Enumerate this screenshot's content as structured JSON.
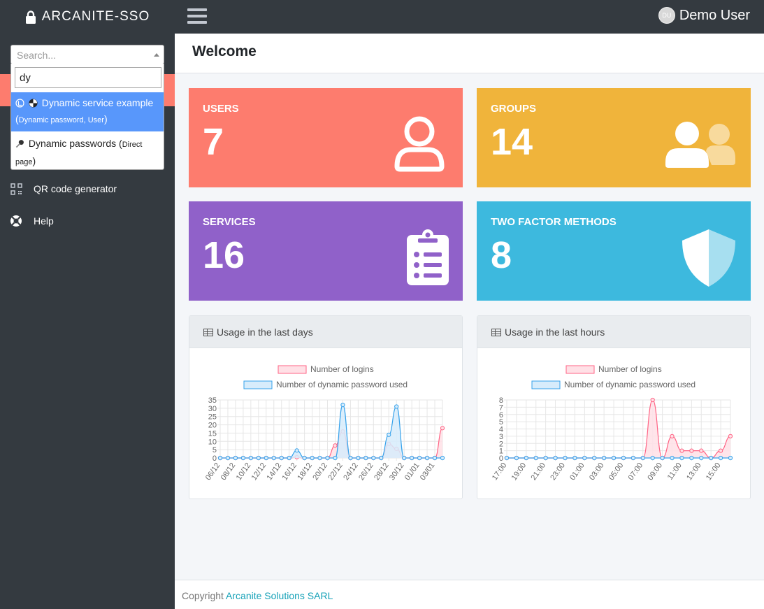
{
  "header": {
    "brand": "ARCANITE-SSO",
    "user_name": "Demo User",
    "user_initials": "DU"
  },
  "sidebar": {
    "search": {
      "placeholder": "Search...",
      "query": "dy",
      "results": [
        {
          "title": "Dynamic service example",
          "open": "(",
          "detail": "Dynamic password, User",
          "close": ")",
          "selected": true
        },
        {
          "title": "Dynamic passwords",
          "open": "(",
          "detail": "Direct page",
          "close": ")",
          "selected": false
        }
      ]
    },
    "items": [
      {
        "label": "QR code generator",
        "icon": "qr-code-icon"
      },
      {
        "label": "Help",
        "icon": "life-ring-icon"
      }
    ]
  },
  "page": {
    "title": "Welcome"
  },
  "stats": [
    {
      "label": "USERS",
      "value": "7",
      "color": "#fd7c6e",
      "icon": "user-icon"
    },
    {
      "label": "GROUPS",
      "value": "14",
      "color": "#f0b43b",
      "icon": "users-icon"
    },
    {
      "label": "SERVICES",
      "value": "16",
      "color": "#9061c9",
      "icon": "clipboard-list-icon"
    },
    {
      "label": "TWO FACTOR METHODS",
      "value": "8",
      "color": "#3db9de",
      "icon": "shield-icon"
    }
  ],
  "cards": {
    "days_title": "Usage in the last days",
    "hours_title": "Usage in the last hours"
  },
  "chart_data": [
    {
      "type": "area",
      "title": "Usage in the last days",
      "x": [
        "06/12",
        "07/12",
        "08/12",
        "09/12",
        "10/12",
        "11/12",
        "12/12",
        "13/12",
        "14/12",
        "15/12",
        "16/12",
        "17/12",
        "18/12",
        "19/12",
        "20/12",
        "21/12",
        "22/12",
        "23/12",
        "24/12",
        "25/12",
        "26/12",
        "27/12",
        "28/12",
        "29/12",
        "30/12",
        "31/12",
        "01/01",
        "02/01",
        "03/01",
        "04/01"
      ],
      "x_ticks": [
        "06/12",
        "08/12",
        "10/12",
        "12/12",
        "14/12",
        "16/12",
        "18/12",
        "20/12",
        "22/12",
        "24/12",
        "26/12",
        "28/12",
        "30/12",
        "01/01",
        "03/01"
      ],
      "y_ticks": [
        0,
        5,
        10,
        15,
        20,
        25,
        30,
        35
      ],
      "ylim": [
        0,
        35
      ],
      "grid": true,
      "legend_position": "top",
      "series": [
        {
          "name": "Number of logins",
          "color": "#ff6384",
          "fill": "#ffe0e6",
          "values": [
            0,
            0,
            0,
            0,
            0,
            0,
            0,
            0,
            0,
            0,
            0.5,
            0,
            0,
            0,
            0,
            7.5,
            16,
            0,
            0,
            0,
            0,
            0,
            8.5,
            5.5,
            0,
            0,
            0,
            0,
            0,
            18
          ]
        },
        {
          "name": "Number of dynamic password used",
          "color": "#36a2eb",
          "fill": "#d7ecfb",
          "values": [
            0,
            0,
            0,
            0,
            0,
            0,
            0,
            0,
            0,
            0,
            4.5,
            0,
            0,
            0,
            0,
            0,
            32,
            0,
            0,
            0,
            0,
            0,
            14,
            31,
            0,
            0,
            0,
            0,
            0,
            0
          ]
        }
      ]
    },
    {
      "type": "area",
      "title": "Usage in the last hours",
      "x": [
        "17:00",
        "18:00",
        "19:00",
        "20:00",
        "21:00",
        "22:00",
        "23:00",
        "00:00",
        "01:00",
        "02:00",
        "03:00",
        "04:00",
        "05:00",
        "06:00",
        "07:00",
        "08:00",
        "09:00",
        "10:00",
        "11:00",
        "12:00",
        "13:00",
        "14:00",
        "15:00",
        "16:00"
      ],
      "x_ticks": [
        "17:00",
        "19:00",
        "21:00",
        "23:00",
        "01:00",
        "03:00",
        "05:00",
        "07:00",
        "09:00",
        "11:00",
        "13:00",
        "15:00"
      ],
      "y_ticks": [
        0,
        1,
        2,
        3,
        4,
        5,
        6,
        7,
        8
      ],
      "ylim": [
        0,
        8
      ],
      "grid": true,
      "legend_position": "top",
      "series": [
        {
          "name": "Number of logins",
          "color": "#ff6384",
          "fill": "#ffe0e6",
          "values": [
            0,
            0,
            0,
            0,
            0,
            0,
            0,
            0,
            0,
            0,
            0,
            0,
            0,
            0,
            0,
            8,
            0,
            3,
            1,
            1,
            1,
            0,
            1,
            3
          ]
        },
        {
          "name": "Number of dynamic password used",
          "color": "#36a2eb",
          "fill": "#d7ecfb",
          "values": [
            0,
            0,
            0,
            0,
            0,
            0,
            0,
            0,
            0,
            0,
            0,
            0,
            0,
            0,
            0,
            0,
            0,
            0,
            0,
            0,
            0,
            0,
            0,
            0
          ]
        }
      ]
    }
  ],
  "footer": {
    "prefix": "Copyright",
    "company": "Arcanite Solutions SARL"
  }
}
